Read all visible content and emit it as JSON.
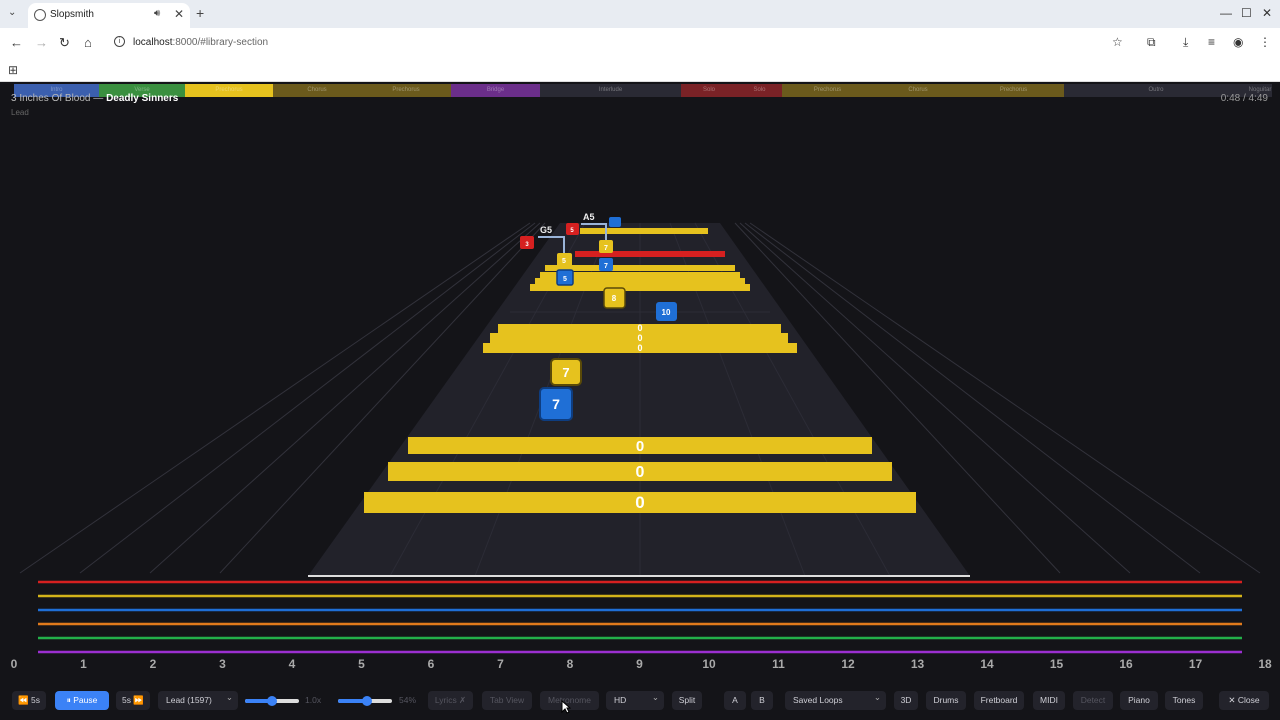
{
  "browser": {
    "tab_title": "Slopsmith",
    "url_host": "localhost",
    "url_path": ":8000/#library-section"
  },
  "sections": [
    {
      "label": "Intro",
      "color": "#3b5fae",
      "w": 85
    },
    {
      "label": "Verse",
      "color": "#3a8f3f",
      "w": 86
    },
    {
      "label": "Prechorus",
      "color": "#e6c21e",
      "w": 88
    },
    {
      "label": "Chorus",
      "color": "#6b5a1c",
      "w": 88
    },
    {
      "label": "Prechorus",
      "color": "#6b5a1c",
      "w": 90
    },
    {
      "label": "Bridge",
      "color": "#6b2e8a",
      "w": 89
    },
    {
      "label": "Interlude",
      "color": "#2a2a34",
      "w": 141
    },
    {
      "label": "Solo",
      "color": "#7a2226",
      "w": 56
    },
    {
      "label": "Solo",
      "color": "#7a2226",
      "w": 45
    },
    {
      "label": "Prechorus",
      "color": "#6b5a1c",
      "w": 91
    },
    {
      "label": "Chorus",
      "color": "#6b5a1c",
      "w": 90
    },
    {
      "label": "Prechorus",
      "color": "#6b5a1c",
      "w": 101
    },
    {
      "label": "Outro",
      "color": "#2a2a34",
      "w": 184
    },
    {
      "label": "Noguitar",
      "color": "#2a2a34",
      "w": 24
    }
  ],
  "song": {
    "artist": "3 Inches Of Blood",
    "separator": "—",
    "title": "Deadly Sinners",
    "arrangement": "Lead",
    "time": "0:48 / 4:49"
  },
  "string_colors": [
    "#d62020",
    "#d4b41a",
    "#1f6fd6",
    "#e07a1c",
    "#23b04a",
    "#9b2fd0"
  ],
  "fret_numbers": [
    "0",
    "1",
    "2",
    "3",
    "4",
    "5",
    "6",
    "7",
    "8",
    "9",
    "10",
    "11",
    "12",
    "13",
    "14",
    "15",
    "16",
    "17",
    "18"
  ],
  "chords": [
    "G5",
    "A5"
  ],
  "notes": {
    "n1": "7",
    "n2": "7",
    "n3": "0",
    "n4": "0",
    "n5": "0",
    "n6": "10",
    "n7": "8",
    "n8": "5",
    "n9": "5",
    "n10": "7",
    "n11": "7",
    "n12": "5",
    "n13": "3",
    "n14": "0",
    "n15": "0",
    "n16": "0"
  },
  "toolbar": {
    "rewind": "⏪ 5s",
    "pause": "⏸ Pause",
    "forward": "5s ⏩",
    "arrangement_select": "Lead (1597)",
    "speed_value": "1.0x",
    "volume_value": "54%",
    "lyrics": "Lyrics ✗",
    "tab_view": "Tab View",
    "metronome": "Metronome",
    "quality_select": "HD",
    "split": "Split",
    "a": "A",
    "b": "B",
    "saved_loops": "Saved Loops",
    "three_d": "3D",
    "drums": "Drums",
    "fretboard": "Fretboard",
    "midi": "MIDI",
    "detect": "Detect",
    "piano": "Piano",
    "tones": "Tones",
    "close": "✕ Close"
  },
  "colors": {
    "accent": "#3b82f6",
    "note_yellow": "#e6c21e",
    "note_blue": "#1f6fd6",
    "note_red": "#d62020"
  },
  "speed_level": 0.5,
  "volume_level": 0.54
}
